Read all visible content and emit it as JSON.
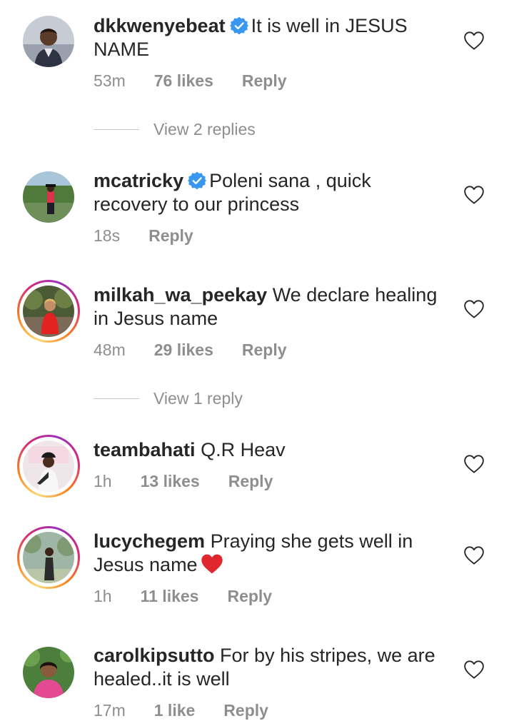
{
  "comments": [
    {
      "username": "dkkwenyebeat",
      "verified": true,
      "text": "It is well in JESUS NAME",
      "time": "53m",
      "likes": "76 likes",
      "reply": "Reply",
      "view_replies": "View 2 replies"
    },
    {
      "username": "mcatricky",
      "verified": true,
      "text": "Poleni sana , quick recovery to our princess",
      "time": "18s",
      "likes": "",
      "reply": "Reply"
    },
    {
      "username": "milkah_wa_peekay",
      "verified": false,
      "text": "We declare healing in Jesus name",
      "time": "48m",
      "likes": "29 likes",
      "reply": "Reply",
      "view_replies": "View 1 reply"
    },
    {
      "username": "teambahati",
      "verified": false,
      "text": "Q.R Heav",
      "time": "1h",
      "likes": "13 likes",
      "reply": "Reply"
    },
    {
      "username": "lucychegem",
      "verified": false,
      "text": "Praying she gets well in Jesus name",
      "time": "1h",
      "likes": "11 likes",
      "reply": "Reply"
    },
    {
      "username": "carolkipsutto",
      "verified": false,
      "text": "For by his stripes, we are healed..it is well",
      "time": "17m",
      "likes": "1 like",
      "reply": "Reply"
    }
  ],
  "colors": {
    "text": "#262626",
    "secondary": "#8e8e8e",
    "verified": "#3897f0",
    "emoji_heart": "#e0262e"
  },
  "icons": {
    "like": "heart-outline-icon",
    "verified": "verified-badge-icon",
    "emoji": "red-heart-emoji"
  }
}
